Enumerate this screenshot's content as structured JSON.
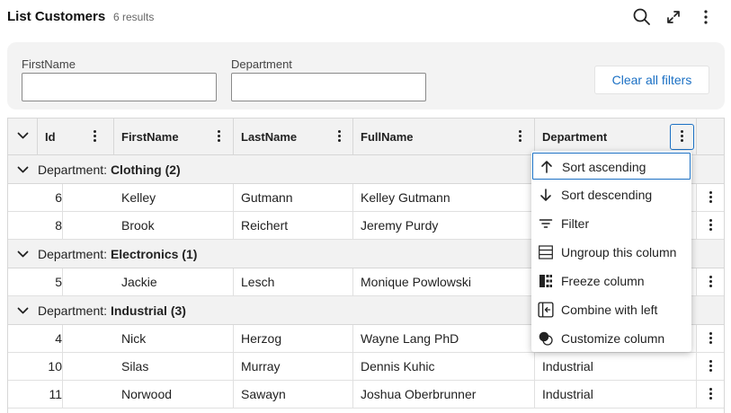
{
  "header": {
    "title": "List Customers",
    "count": "6 results",
    "icons": [
      "search-icon",
      "expand-icon",
      "more-vertical-icon"
    ]
  },
  "filters": {
    "firstname_label": "FirstName",
    "firstname_value": "",
    "department_label": "Department",
    "department_value": "",
    "clear_label": "Clear all filters"
  },
  "columns": {
    "id": "Id",
    "firstname": "FirstName",
    "lastname": "LastName",
    "fullname": "FullName",
    "department": "Department"
  },
  "groups": [
    {
      "prefix": "Department:",
      "name": "Clothing (2)",
      "rows": [
        {
          "id": "6",
          "first": "Kelley",
          "last": "Gutmann",
          "full": "Kelley Gutmann",
          "dept": ""
        },
        {
          "id": "8",
          "first": "Brook",
          "last": "Reichert",
          "full": "Jeremy Purdy",
          "dept": ""
        }
      ]
    },
    {
      "prefix": "Department:",
      "name": "Electronics (1)",
      "rows": [
        {
          "id": "5",
          "first": "Jackie",
          "last": "Lesch",
          "full": "Monique Powlowski",
          "dept": ""
        }
      ]
    },
    {
      "prefix": "Department:",
      "name": "Industrial (3)",
      "rows": [
        {
          "id": "4",
          "first": "Nick",
          "last": "Herzog",
          "full": "Wayne Lang PhD",
          "dept": ""
        },
        {
          "id": "10",
          "first": "Silas",
          "last": "Murray",
          "full": "Dennis Kuhic",
          "dept": "Industrial"
        },
        {
          "id": "11",
          "first": "Norwood",
          "last": "Sawayn",
          "full": "Joshua Oberbrunner",
          "dept": "Industrial"
        }
      ]
    }
  ],
  "column_menu": {
    "items": [
      {
        "label": "Sort ascending",
        "icon": "arrow-up-icon"
      },
      {
        "label": "Sort descending",
        "icon": "arrow-down-icon"
      },
      {
        "label": "Filter",
        "icon": "filter-icon"
      },
      {
        "label": "Ungroup this column",
        "icon": "ungroup-icon"
      },
      {
        "label": "Freeze column",
        "icon": "freeze-icon"
      },
      {
        "label": "Combine with left",
        "icon": "combine-left-icon"
      },
      {
        "label": "Customize column",
        "icon": "customize-icon"
      }
    ]
  },
  "colors": {
    "accent": "#1b70c4",
    "header_bg": "#f2f2f2",
    "filter_bg": "#f3f3f3",
    "border": "#d7d7d7"
  }
}
